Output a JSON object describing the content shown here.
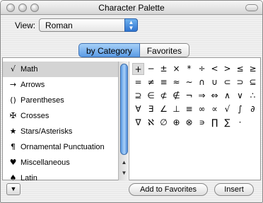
{
  "window": {
    "title": "Character Palette"
  },
  "view": {
    "label": "View:",
    "selected": "Roman",
    "arrows_icon": "popup-arrows-icon"
  },
  "tabs": [
    {
      "label": "by Category",
      "active": true
    },
    {
      "label": "Favorites",
      "active": false
    }
  ],
  "categories": [
    {
      "glyph": "√",
      "label": "Math",
      "selected": true
    },
    {
      "glyph": "→",
      "label": "Arrows"
    },
    {
      "glyph": "()",
      "label": "Parentheses"
    },
    {
      "glyph": "✠",
      "label": "Crosses"
    },
    {
      "glyph": "★",
      "label": "Stars/Asterisks"
    },
    {
      "glyph": "¶",
      "label": "Ornamental Punctuation"
    },
    {
      "glyph": "♥",
      "label": "Miscellaneous"
    },
    {
      "glyph": "♠",
      "label": "Latin"
    }
  ],
  "characters": [
    [
      "+",
      "−",
      "±",
      "×",
      "*",
      "÷",
      "<",
      ">",
      "≤",
      "≥"
    ],
    [
      "=",
      "≠",
      "≡",
      "≈",
      "∼",
      "∩",
      "∪",
      "⊂",
      "⊃",
      "⊆"
    ],
    [
      "⊇",
      "∈",
      "⊄",
      "∉",
      "¬",
      "⇒",
      "⇔",
      "∧",
      "∨",
      "∴"
    ],
    [
      "∀",
      "∃",
      "∠",
      "⊥",
      "≡",
      "∞",
      "∝",
      "√",
      "∫",
      "∂"
    ],
    [
      "∇",
      "ℵ",
      "∅",
      "⊕",
      "⊗",
      "∍",
      "∏",
      "∑",
      "·",
      ""
    ]
  ],
  "selected_character": "+",
  "footer": {
    "menu_icon": "triangle-down-icon",
    "add_to_favorites": "Add to Favorites",
    "insert": "Insert"
  }
}
